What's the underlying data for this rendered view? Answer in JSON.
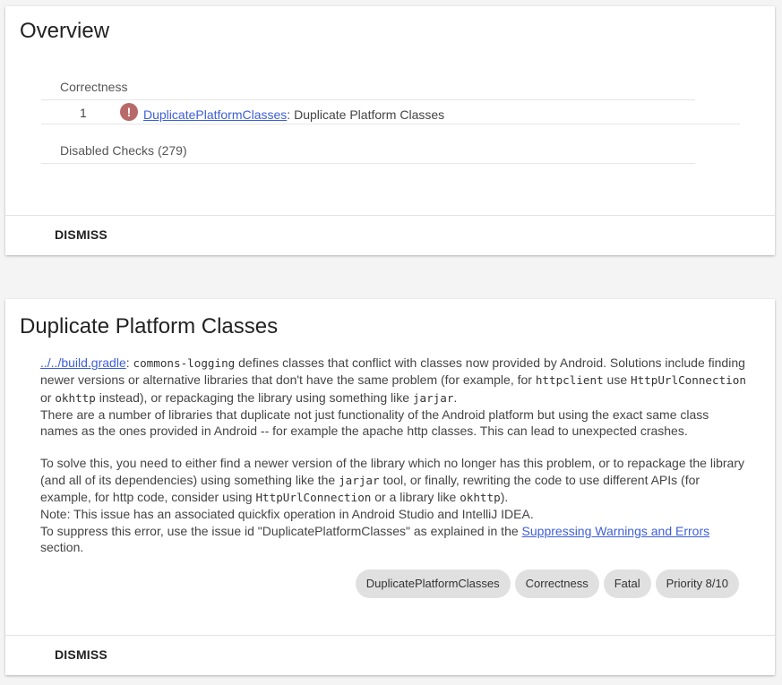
{
  "overview": {
    "title": "Overview",
    "category": "Correctness",
    "issue": {
      "count": "1",
      "icon": "error-icon",
      "icon_glyph": "!",
      "id_link": "DuplicatePlatformClasses",
      "separator": ": ",
      "summary": "Duplicate Platform Classes"
    },
    "disabled_checks": "Disabled Checks (279)",
    "dismiss_label": "DISMISS"
  },
  "detail": {
    "title": "Duplicate Platform Classes",
    "location_link": "../../build.gradle",
    "t1": ": ",
    "c1": "commons-logging",
    "t2": " defines classes that conflict with classes now provided by Android. Solutions include finding newer versions or alternative libraries that don't have the same problem (for example, for ",
    "c2": "httpclient",
    "t3": " use ",
    "c3": "HttpUrlConnection",
    "t4": " or ",
    "c4": "okhttp",
    "t5": " instead), or repackaging the library using something like ",
    "c5": "jarjar",
    "t6": ".",
    "para2": "There are a number of libraries that duplicate not just functionality of the Android platform but using the exact same class names as the ones provided in Android -- for example the apache http classes. This can lead to unexpected crashes.",
    "s1": "To solve this, you need to either find a newer version of the library which no longer has this problem, or to repackage the library (and all of its dependencies) using something like the ",
    "sc1": "jarjar",
    "s2": " tool, or finally, rewriting the code to use different APIs (for example, for http code, consider using ",
    "sc2": "HttpUrlConnection",
    "s3": " or a library like ",
    "sc3": "okhttp",
    "s4": ").",
    "note": "Note: This issue has an associated quickfix operation in Android Studio and IntelliJ IDEA.",
    "suppress_pre": "To suppress this error, use the issue id \"DuplicatePlatformClasses\" as explained in the ",
    "suppress_link": "Suppressing Warnings and Errors",
    "suppress_post": " section.",
    "chips": [
      "DuplicatePlatformClasses",
      "Correctness",
      "Fatal",
      "Priority 8/10"
    ],
    "dismiss_label": "DISMISS"
  },
  "colors": {
    "link": "#3d5fd6",
    "error_icon": "#b86a6a",
    "chip_bg": "#e0e0e0",
    "page_bg": "#f4f4f4"
  }
}
